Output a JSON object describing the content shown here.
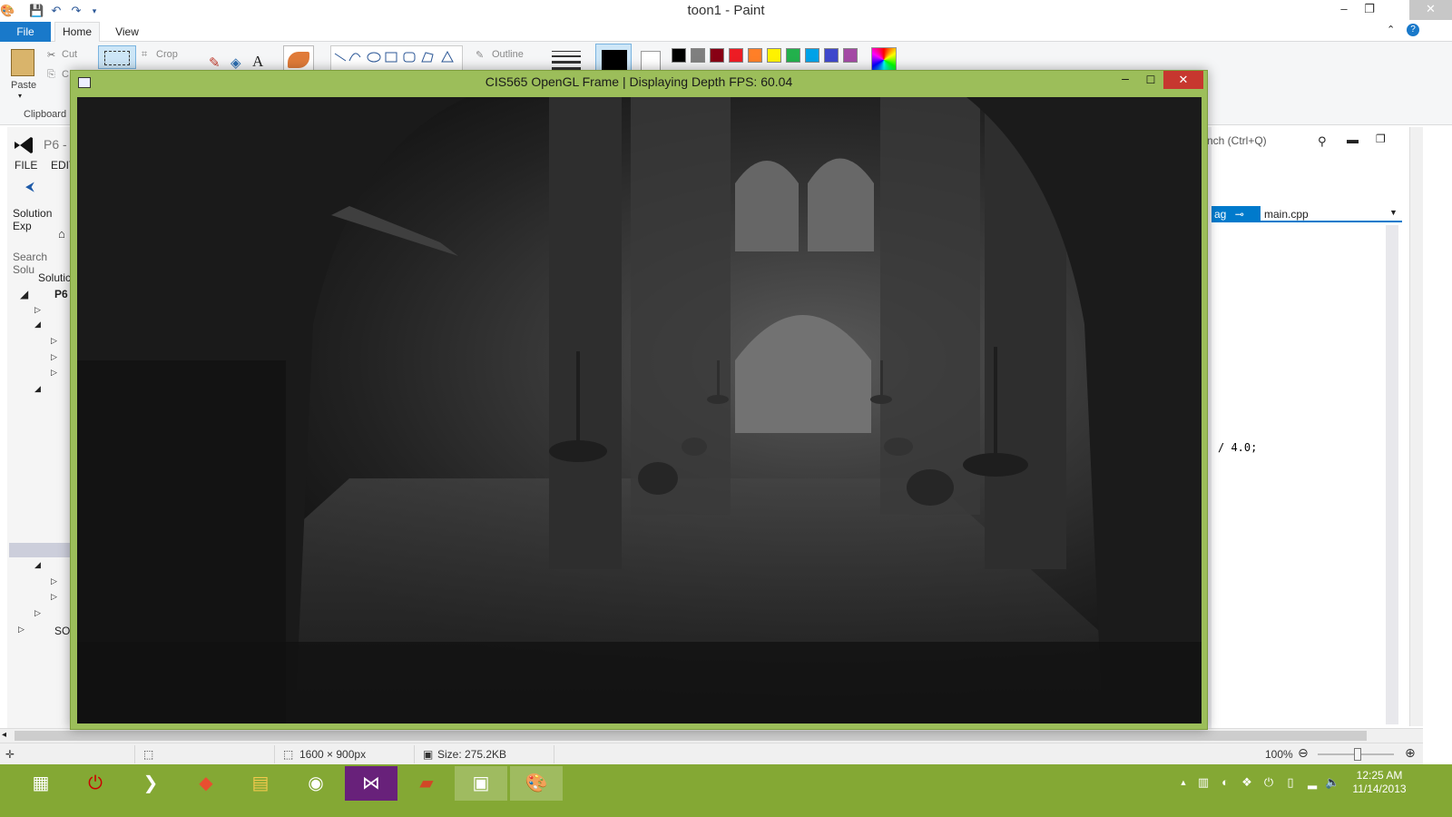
{
  "paint": {
    "window_title": "toon1 - Paint",
    "tabs": {
      "file": "File",
      "home": "Home",
      "view": "View"
    },
    "ribbon": {
      "paste": "Paste",
      "cut": "Cut",
      "copy_partial": "C",
      "crop": "Crop",
      "outline": "Outline",
      "clipboard_group": "Clipboard",
      "palette": [
        "#000000",
        "#7f7f7f",
        "#880015",
        "#ed1c24",
        "#ff7f27",
        "#fff200",
        "#22b14c",
        "#00a2e8",
        "#3f48cc",
        "#a349a4"
      ]
    },
    "status": {
      "dimensions": "1600 × 900px",
      "size": "Size: 275.2KB",
      "zoom": "100%"
    }
  },
  "gl_window": {
    "title": "CIS565 OpenGL Frame | Displaying Depth FPS: 60.04"
  },
  "visual_studio": {
    "project_short": "P6 -",
    "menu_file": "FILE",
    "menu_edit": "EDIT",
    "solution_explorer": "Solution Exp",
    "search_solution": "Search Solu",
    "solution_node": "Solutic",
    "project_node": "P6",
    "so_node": "SO",
    "quick_launch": "nch (Ctrl+Q)",
    "tab_active_partial": "ag",
    "tab_main": "main.cpp",
    "code_fragment": "/ 4.0;"
  },
  "taskbar": {
    "time": "12:25 AM",
    "date": "11/14/2013"
  }
}
